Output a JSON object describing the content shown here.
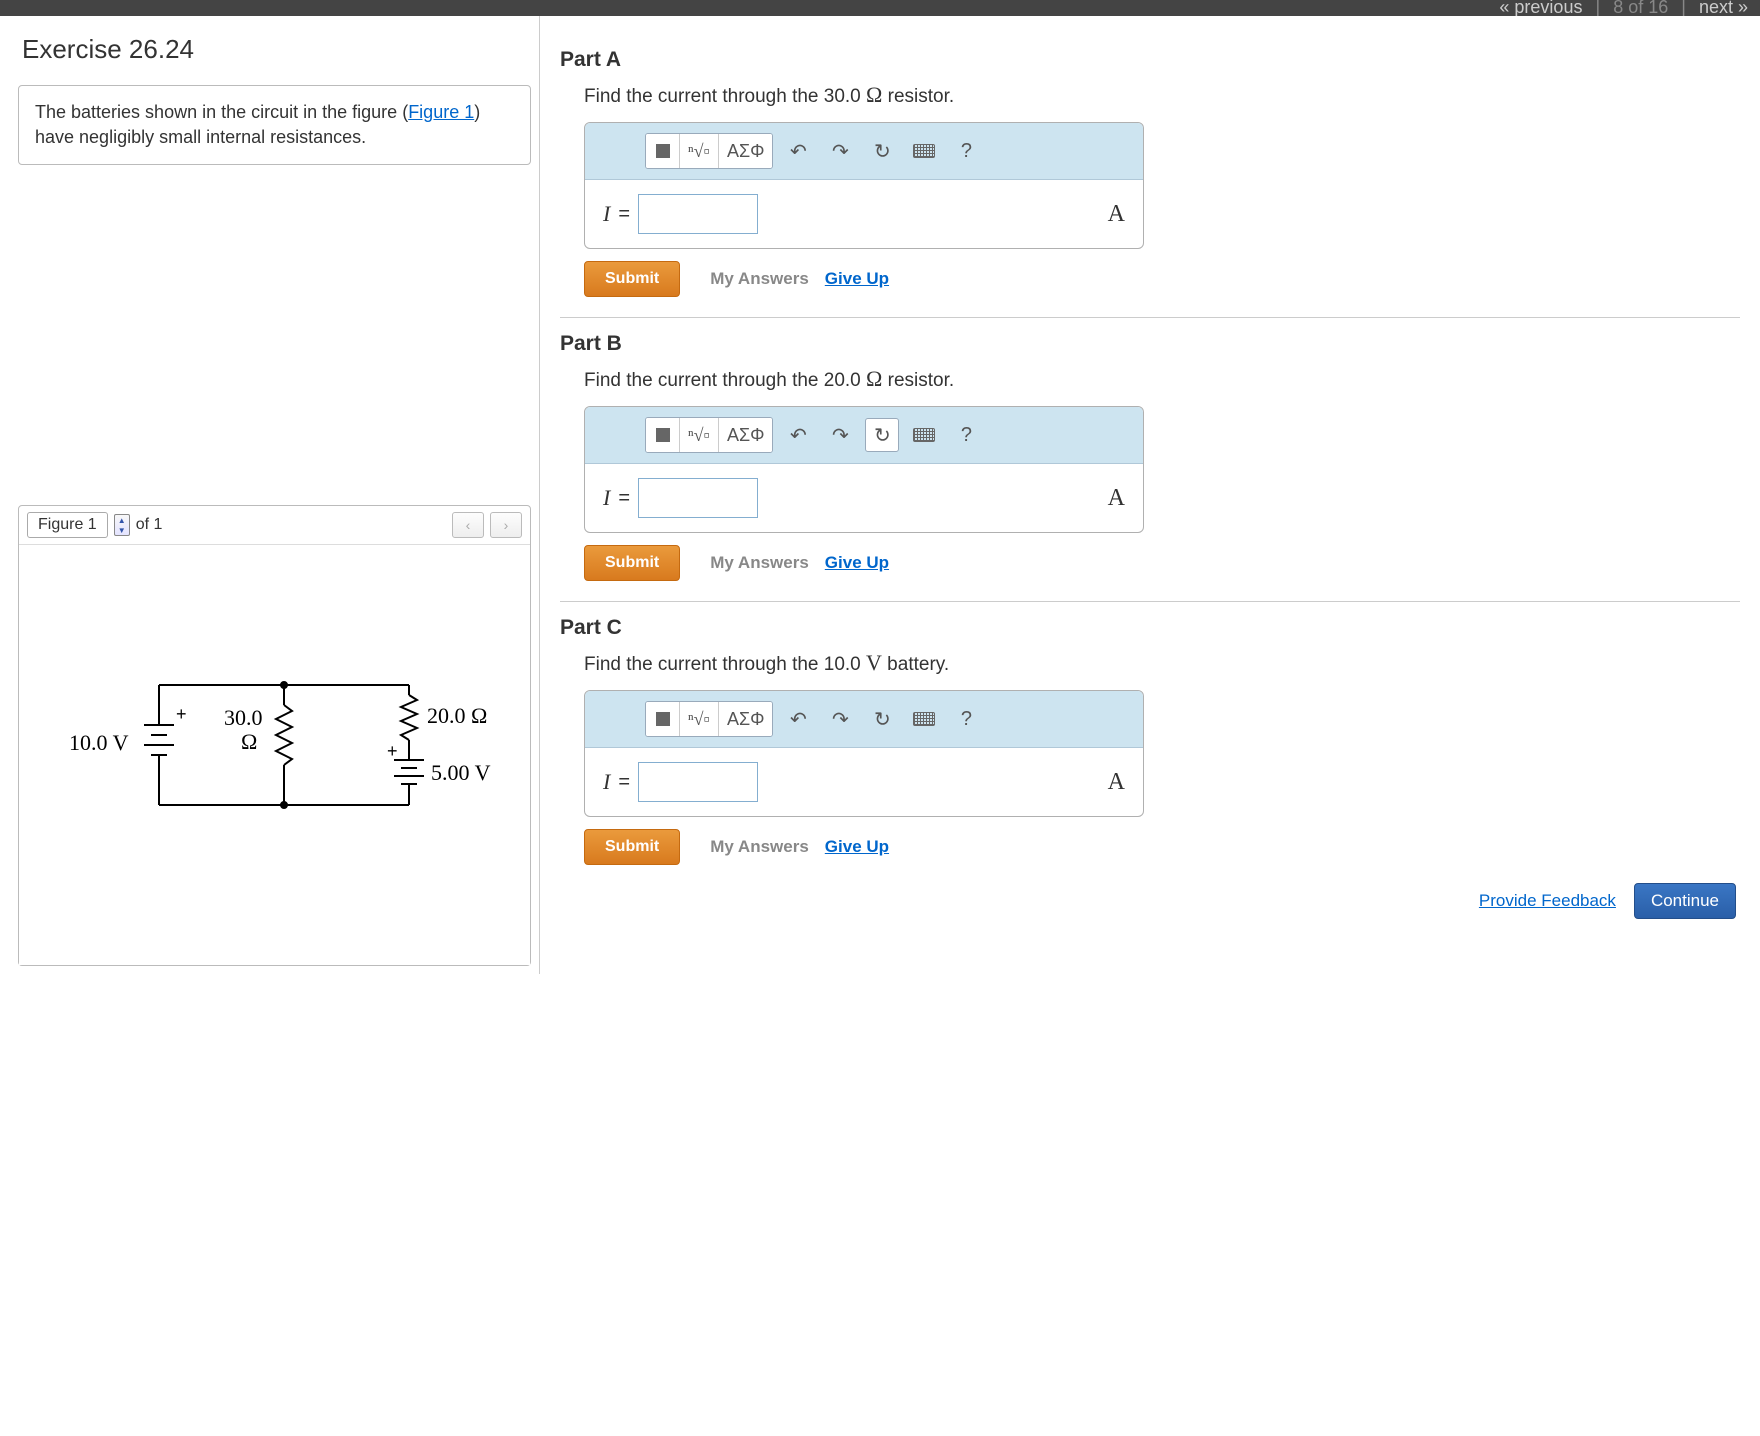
{
  "nav": {
    "previous": "« previous",
    "position": "8 of 16",
    "next": "next »"
  },
  "exercise": {
    "title": "Exercise 26.24",
    "problem_text_prefix": "The batteries shown in the circuit in the figure (",
    "figure_link_text": "Figure 1",
    "problem_text_suffix": ") have negligibly small internal resistances."
  },
  "figure": {
    "label": "Figure 1",
    "of_text": "of 1",
    "prev_icon": "‹",
    "next_icon": "›",
    "circuit": {
      "v1": "10.0 V",
      "r1": "30.0",
      "r1_unit": "Ω",
      "r2": "20.0 Ω",
      "v2": "5.00 V"
    }
  },
  "parts": [
    {
      "title": "Part A",
      "prompt_prefix": "Find the current through the 30.0 ",
      "prompt_symbol": "Ω",
      "prompt_suffix": " resistor.",
      "variable": "I",
      "unit": "A",
      "reset_boxed": false
    },
    {
      "title": "Part B",
      "prompt_prefix": "Find the current through the 20.0 ",
      "prompt_symbol": "Ω",
      "prompt_suffix": " resistor.",
      "variable": "I",
      "unit": "A",
      "reset_boxed": true
    },
    {
      "title": "Part C",
      "prompt_prefix": "Find the current through the 10.0 ",
      "prompt_symbol": "V",
      "prompt_suffix": " battery.",
      "variable": "I",
      "unit": "A",
      "reset_boxed": false
    }
  ],
  "toolbar": {
    "greek_label": "ΑΣΦ",
    "help": "?"
  },
  "buttons": {
    "submit": "Submit",
    "my_answers": "My Answers",
    "give_up": "Give Up",
    "feedback": "Provide Feedback",
    "continue": "Continue"
  }
}
